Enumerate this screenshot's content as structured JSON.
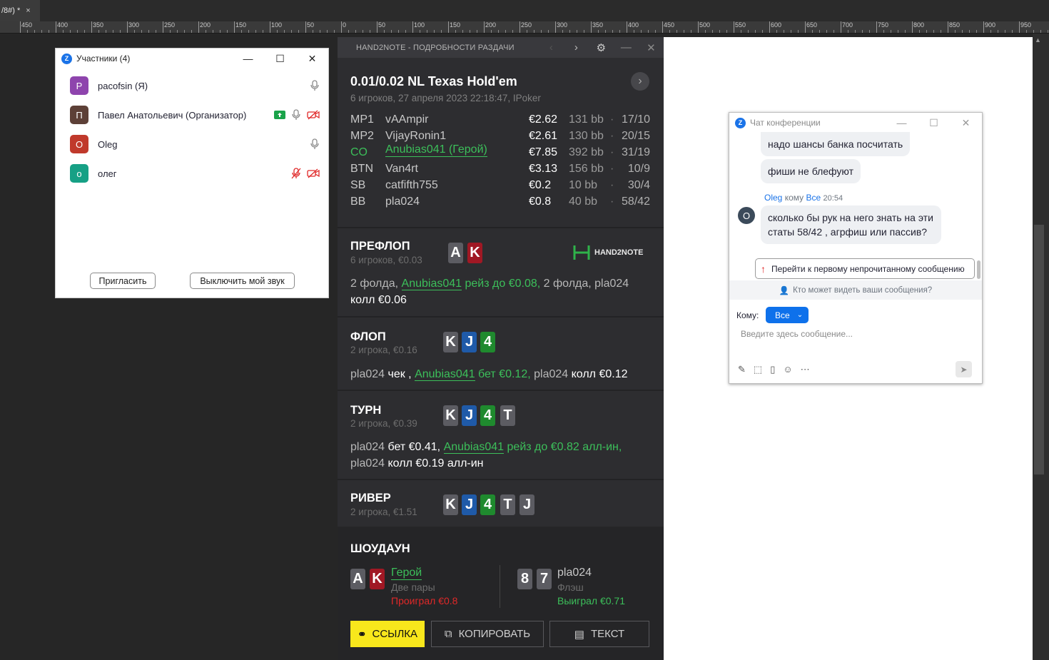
{
  "app": {
    "tab_title": "/8#) *",
    "tab_close": "×",
    "ruler_labels": [
      "450",
      "400",
      "350",
      "300",
      "250",
      "200",
      "150",
      "100",
      "50",
      "0",
      "50",
      "100",
      "150",
      "200",
      "250",
      "300",
      "350",
      "400",
      "450",
      "500",
      "550",
      "600",
      "650",
      "700",
      "750",
      "800",
      "850",
      "900",
      "950"
    ]
  },
  "participants": {
    "title": "Участники (4)",
    "people": [
      {
        "initial": "P",
        "name": "pacofsin (Я)",
        "color": "#8e44ad"
      },
      {
        "initial": "П",
        "name": "Павел Анатольевич (Организатор)",
        "color": "#5d4037"
      },
      {
        "initial": "O",
        "name": "Oleg",
        "color": "#c0392b"
      },
      {
        "initial": "о",
        "name": "олег",
        "color": "#16a085"
      }
    ],
    "invite_label": "Пригласить",
    "mute_label": "Выключить мой звук"
  },
  "hand": {
    "header_title": "HAND2NOTE - ПОДРОБНОСТИ РАЗДАЧИ",
    "game_title": "0.01/0.02 NL Texas Hold'em",
    "game_sub": "6 игроков, 27 апреля 2023 22:18:47, IPoker",
    "players": [
      {
        "pos": "MP1",
        "name": "vAAmpir",
        "stack": "€2.62",
        "bb": "131 bb",
        "stats": "17/10"
      },
      {
        "pos": "MP2",
        "name": "VijayRonin1",
        "stack": "€2.61",
        "bb": "130 bb",
        "stats": "20/15"
      },
      {
        "pos": "CO",
        "name": "Anubias041 (Герой)",
        "stack": "€7.85",
        "bb": "392 bb",
        "stats": "31/19"
      },
      {
        "pos": "BTN",
        "name": "Van4rt",
        "stack": "€3.13",
        "bb": "156 bb",
        "stats": "10/9"
      },
      {
        "pos": "SB",
        "name": "catfifth755",
        "stack": "€0.2",
        "bb": "10 bb",
        "stats": "30/4"
      },
      {
        "pos": "BB",
        "name": "pla024",
        "stack": "€0.8",
        "bb": "40 bb",
        "stats": "58/42"
      }
    ],
    "stat_sep": "·",
    "logo_text": "HAND2NOTE",
    "preflop": {
      "name": "ПРЕФЛОП",
      "sub": "6 игроков, €0.03",
      "cards": [
        "A",
        "K"
      ],
      "a1": "2 фолда,",
      "a2": "Anubias041",
      "a3": "рейз до €0.08,",
      "a4": "2 фолда, pla024",
      "a5": "колл €0.06"
    },
    "flop": {
      "name": "ФЛОП",
      "sub": "2 игрока, €0.16",
      "cards": [
        "K",
        "J",
        "4"
      ],
      "a1": "pla024",
      "a2": "чек ,",
      "a3": "Anubias041",
      "a4": "бет €0.12,",
      "a5": "pla024",
      "a6": "колл €0.12"
    },
    "turn": {
      "name": "ТУРН",
      "sub": "2 игрока, €0.39",
      "cards": [
        "K",
        "J",
        "4",
        "T"
      ],
      "a1": "pla024",
      "a2": "бет €0.41,",
      "a3": "Anubias041",
      "a4": "рейз до €0.82 алл-ин,",
      "a5": "pla024",
      "a6": "колл €0.19 алл-ин"
    },
    "river": {
      "name": "РИВЕР",
      "sub": "2 игрока, €1.51",
      "cards": [
        "K",
        "J",
        "4",
        "T",
        "J"
      ]
    },
    "showdown": {
      "name": "ШОУДАУН",
      "hero": {
        "cards": [
          "A",
          "K"
        ],
        "name": "Герой",
        "hand": "Две пары",
        "result": "Проиграл €0.8"
      },
      "villain": {
        "cards": [
          "8",
          "7"
        ],
        "name": "pla024",
        "hand": "Флэш",
        "result": "Выиграл €0.71"
      }
    },
    "buttons": {
      "link": "ССЫЛКА",
      "copy": "КОПИРОВАТЬ",
      "text": "ТЕКСТ"
    }
  },
  "chat": {
    "title": "Чат конференции",
    "msg1": "надо шансы банка посчитать",
    "msg2": "фиши не блефуют",
    "sender": "Oleg",
    "sender_to": "кому",
    "sender_all": "Все",
    "sender_time": "20:54",
    "sender_initial": "O",
    "msg3": "сколько бы рук на него знать на эти статы 58/42 , агрфиш или пассив?",
    "unread_jump": "Перейти к первому непрочитанному сообщению",
    "who_can_see": "Кто может видеть ваши сообщения?",
    "to_label": "Кому:",
    "to_value": "Все",
    "input_placeholder": "Введите здесь сообщение..."
  }
}
